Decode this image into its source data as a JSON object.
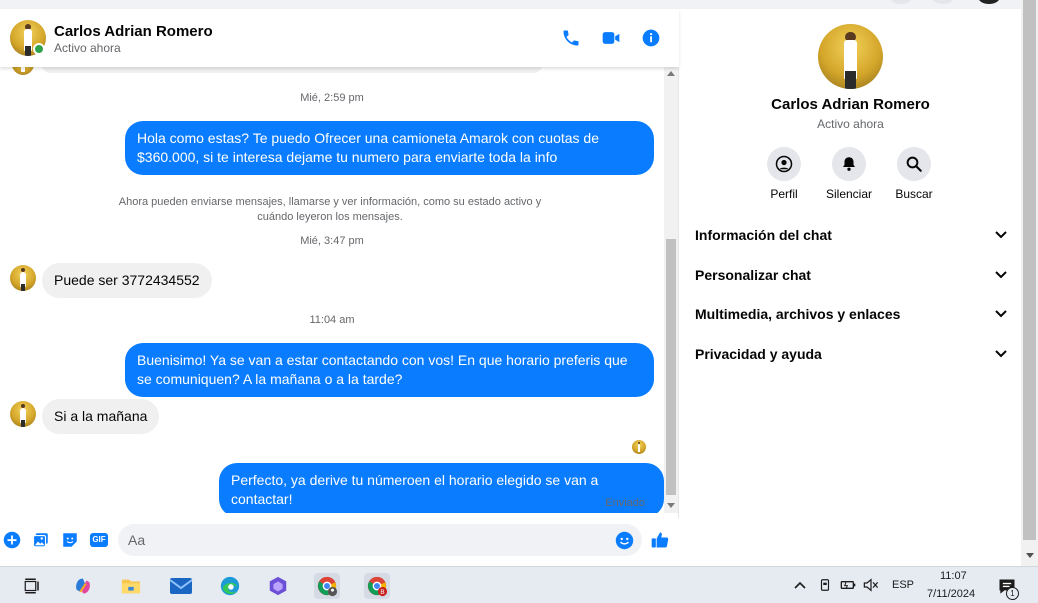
{
  "colors": {
    "messenger_blue": "#0a7cff",
    "online_green": "#31a24c"
  },
  "header": {
    "name": "Carlos Adrian Romero",
    "status": "Activo ahora",
    "icons": [
      "phone-icon",
      "video-call-icon",
      "info-icon"
    ]
  },
  "messages": {
    "stamp1": "Mié, 2:59 pm",
    "out1": "Hola como estas? Te puedo Ofrecer una camioneta Amarok con cuotas de $360.000, si te interesa dejame tu numero para enviarte toda la info",
    "notice": "Ahora pueden enviarse mensajes, llamarse y ver información, como su estado activo y cuándo leyeron los mensajes.",
    "stamp2": "Mié, 3:47 pm",
    "in1": "Puede ser 3772434552",
    "stamp3": "11:04 am",
    "out2": "Buenisimo! Ya se van a estar contactando con vos! En que horario preferis que se comuniquen? A la mañana o a la tarde?",
    "in2": "Si a la mañana",
    "out3": "Perfecto, ya derive tu númeroen el horario elegido se van a contactar!",
    "sent_label": "Enviado"
  },
  "composer": {
    "placeholder": "Aa",
    "gif_label": "GIF",
    "icons": [
      "plus-icon",
      "photo-icon",
      "sticker-icon",
      "gif-icon",
      "emoji-icon",
      "thumbs-up-icon"
    ]
  },
  "info": {
    "name": "Carlos Adrian Romero",
    "status": "Activo ahora",
    "actions": [
      {
        "label": "Perfil",
        "icon": "profile-icon"
      },
      {
        "label": "Silenciar",
        "icon": "bell-icon"
      },
      {
        "label": "Buscar",
        "icon": "search-icon"
      }
    ],
    "sections": [
      "Información del chat",
      "Personalizar chat",
      "Multimedia, archivos y enlaces",
      "Privacidad y ayuda"
    ]
  },
  "taskbar": {
    "apps": [
      "task-view-icon",
      "copilot-icon",
      "file-explorer-icon",
      "mail-icon",
      "edge-icon",
      "teams-icon",
      "chrome-profile-icon",
      "chrome-icon"
    ],
    "lang": "ESP",
    "time": "11:07",
    "date": "7/11/2024",
    "notification_count": "1"
  }
}
